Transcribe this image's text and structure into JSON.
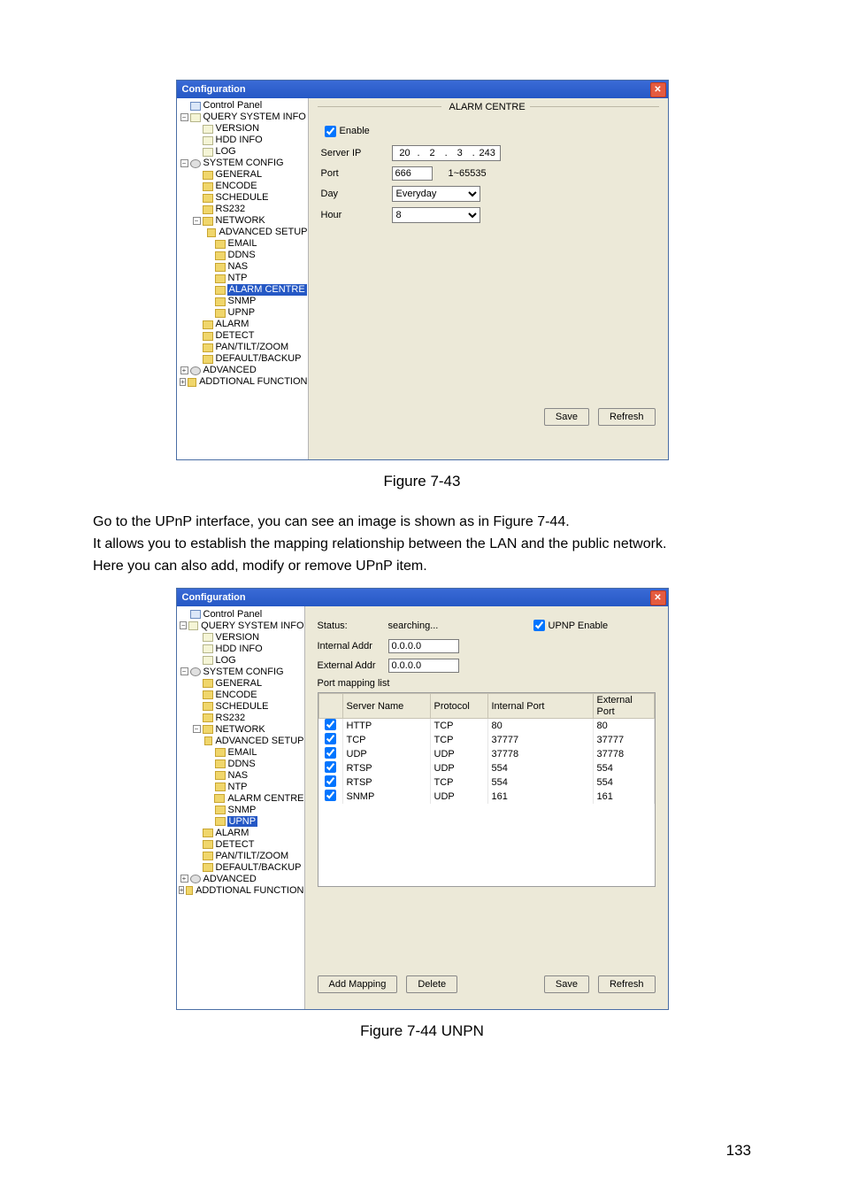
{
  "window": {
    "title": "Configuration"
  },
  "tree": [
    {
      "depth": 0,
      "icon": "panel",
      "exp": "",
      "label": "Control Panel"
    },
    {
      "depth": 0,
      "icon": "file",
      "exp": "minus",
      "label": "QUERY SYSTEM INFO"
    },
    {
      "depth": 1,
      "icon": "file",
      "exp": "",
      "label": "VERSION"
    },
    {
      "depth": 1,
      "icon": "file",
      "exp": "",
      "label": "HDD INFO"
    },
    {
      "depth": 1,
      "icon": "file",
      "exp": "",
      "label": "LOG"
    },
    {
      "depth": 0,
      "icon": "gear",
      "exp": "minus",
      "label": "SYSTEM CONFIG"
    },
    {
      "depth": 1,
      "icon": "folder",
      "exp": "",
      "label": "GENERAL"
    },
    {
      "depth": 1,
      "icon": "folder",
      "exp": "",
      "label": "ENCODE"
    },
    {
      "depth": 1,
      "icon": "folder",
      "exp": "",
      "label": "SCHEDULE"
    },
    {
      "depth": 1,
      "icon": "folder",
      "exp": "",
      "label": "RS232"
    },
    {
      "depth": 1,
      "icon": "folder",
      "exp": "minus",
      "label": "NETWORK"
    },
    {
      "depth": 2,
      "icon": "folder",
      "exp": "",
      "label": "ADVANCED SETUP"
    },
    {
      "depth": 2,
      "icon": "folder",
      "exp": "",
      "label": "EMAIL"
    },
    {
      "depth": 2,
      "icon": "folder",
      "exp": "",
      "label": "DDNS"
    },
    {
      "depth": 2,
      "icon": "folder",
      "exp": "",
      "label": "NAS"
    },
    {
      "depth": 2,
      "icon": "folder",
      "exp": "",
      "label": "NTP"
    },
    {
      "depth": 2,
      "icon": "folder",
      "exp": "",
      "label": "ALARM CENTRE",
      "selectedIn": "alarm"
    },
    {
      "depth": 2,
      "icon": "folder",
      "exp": "",
      "label": "SNMP"
    },
    {
      "depth": 2,
      "icon": "folder",
      "exp": "",
      "label": "UPNP",
      "selectedIn": "upnp"
    },
    {
      "depth": 1,
      "icon": "folder",
      "exp": "",
      "label": "ALARM"
    },
    {
      "depth": 1,
      "icon": "folder",
      "exp": "",
      "label": "DETECT"
    },
    {
      "depth": 1,
      "icon": "folder",
      "exp": "",
      "label": "PAN/TILT/ZOOM"
    },
    {
      "depth": 1,
      "icon": "folder",
      "exp": "",
      "label": "DEFAULT/BACKUP"
    },
    {
      "depth": 0,
      "icon": "gear",
      "exp": "plus",
      "label": "ADVANCED"
    },
    {
      "depth": 0,
      "icon": "folder",
      "exp": "plus",
      "label": "ADDTIONAL FUNCTION"
    }
  ],
  "alarm": {
    "heading": "ALARM CENTRE",
    "enable_label": "Enable",
    "enable_checked": true,
    "server_ip_label": "Server IP",
    "server_ip": [
      "20",
      "2",
      "3",
      "243"
    ],
    "port_label": "Port",
    "port_value": "666",
    "port_hint": "1~65535",
    "day_label": "Day",
    "day_value": "Everyday",
    "hour_label": "Hour",
    "hour_value": "8",
    "save_label": "Save",
    "refresh_label": "Refresh"
  },
  "upnp": {
    "status_label": "Status:",
    "status_value": "searching...",
    "enable_label": "UPNP Enable",
    "enable_checked": true,
    "internal_label": "Internal Addr",
    "internal_value": "0.0.0.0",
    "external_label": "External Addr",
    "external_value": "0.0.0.0",
    "port_list_label": "Port mapping list",
    "headers": {
      "chk": "",
      "name": "Server Name",
      "proto": "Protocol",
      "iport": "Internal Port",
      "eport": "External Port"
    },
    "rows": [
      {
        "chk": true,
        "name": "HTTP",
        "proto": "TCP",
        "iport": "80",
        "eport": "80"
      },
      {
        "chk": true,
        "name": "TCP",
        "proto": "TCP",
        "iport": "37777",
        "eport": "37777"
      },
      {
        "chk": true,
        "name": "UDP",
        "proto": "UDP",
        "iport": "37778",
        "eport": "37778"
      },
      {
        "chk": true,
        "name": "RTSP",
        "proto": "UDP",
        "iport": "554",
        "eport": "554"
      },
      {
        "chk": true,
        "name": "RTSP",
        "proto": "TCP",
        "iport": "554",
        "eport": "554"
      },
      {
        "chk": true,
        "name": "SNMP",
        "proto": "UDP",
        "iport": "161",
        "eport": "161"
      }
    ],
    "add_label": "Add Mapping",
    "delete_label": "Delete",
    "save_label": "Save",
    "refresh_label": "Refresh"
  },
  "captions": {
    "fig1": "Figure 7-43",
    "fig2": "Figure 7-44 UNPN"
  },
  "body": {
    "l1": "Go to the UPnP interface, you can see an image is shown as in Figure 7-44.",
    "l2": "It allows you to establish the mapping relationship between the LAN and the public network.",
    "l3": "Here you can also add, modify or remove UPnP item."
  },
  "page_number": "133"
}
